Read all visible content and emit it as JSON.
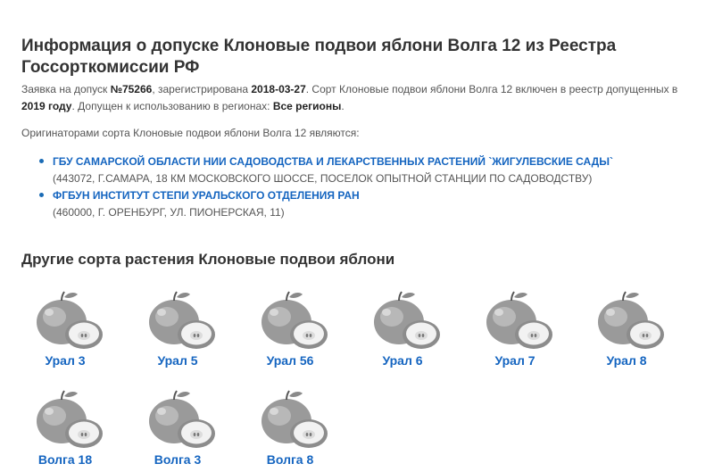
{
  "header": {
    "title": "Информация о допуске Клоновые подвои яблони Волга 12 из Реестра Госсорткомиссии РФ"
  },
  "intro": {
    "t1": "Заявка на допуск ",
    "app_number": "№75266",
    "t2": ", зарегистрирована ",
    "reg_date": "2018-03-27",
    "t3": ". Сорт Клоновые подвои яблони Волга 12 включен в реестр допущенных в ",
    "year": "2019 году",
    "t4": ". Допущен к использованию в регионах: ",
    "regions": "Все регионы",
    "t5": "."
  },
  "originators": {
    "heading": "Оригинаторами сорта Клоновые подвои яблони Волга 12 являются:",
    "items": [
      {
        "name": "ГБУ САМАРСКОЙ ОБЛАСТИ НИИ САДОВОДСТВА И ЛЕКАРСТВЕННЫХ РАСТЕНИЙ `ЖИГУЛЕВСКИЕ САДЫ`",
        "address": "(443072, Г.САМАРА, 18 КМ МОСКОВСКОГО ШОССЕ, ПОСЕЛОК ОПЫТНОЙ СТАНЦИИ ПО САДОВОДСТВУ)"
      },
      {
        "name": "ФГБУН ИНСТИТУТ СТЕПИ УРАЛЬСКОГО ОТДЕЛЕНИЯ РАН",
        "address": "(460000, Г. ОРЕНБУРГ, УЛ. ПИОНЕРСКАЯ, 11)"
      }
    ]
  },
  "other_varieties": {
    "title": "Другие сорта растения Клоновые подвои яблони",
    "icon": "apple-icon",
    "items": [
      {
        "label": "Урал 3"
      },
      {
        "label": "Урал 5"
      },
      {
        "label": "Урал 56"
      },
      {
        "label": "Урал 6"
      },
      {
        "label": "Урал 7"
      },
      {
        "label": "Урал 8"
      },
      {
        "label": "Волга 18"
      },
      {
        "label": "Волга 3"
      },
      {
        "label": "Волга 8"
      }
    ]
  }
}
